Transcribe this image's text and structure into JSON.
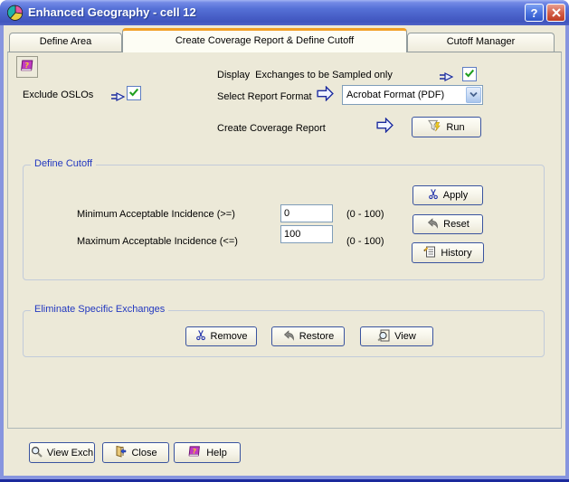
{
  "window": {
    "title": "Enhanced Geography - cell 12"
  },
  "titlebar": {
    "help_glyph": "?"
  },
  "tabs": [
    {
      "label": "Define Area"
    },
    {
      "label": "Create Coverage Report & Define Cutoff"
    },
    {
      "label": "Cutoff Manager"
    }
  ],
  "active_tab": "Create Coverage Report & Define Cutoff",
  "report_section": {
    "display_label": "Display  Exchanges to be Sampled only",
    "display_checked": true,
    "exclude_label": "Exclude OSLOs",
    "exclude_checked": true,
    "format_label": "Select Report Format",
    "format_value": "Acrobat Format (PDF)",
    "create_label": "Create Coverage Report",
    "run_label": "Run"
  },
  "define_cutoff": {
    "title": "Define Cutoff",
    "min_label": "Minimum Acceptable Incidence (>=)",
    "min_value": "0",
    "min_range": "(0 - 100)",
    "max_label": "Maximum Acceptable Incidence (<=)",
    "max_value": "100",
    "max_range": "(0 - 100)",
    "apply_label": "Apply",
    "reset_label": "Reset",
    "history_label": "History"
  },
  "eliminate": {
    "title": "Eliminate Specific Exchanges",
    "remove_label": "Remove",
    "restore_label": "Restore",
    "view_label": "View"
  },
  "footer": {
    "view_exch_label": "View Exch",
    "close_label": "Close",
    "help_label": "Help"
  },
  "colors": {
    "titlebar_blue": "#4A5FC8",
    "frame_blue": "#8795DF",
    "background_beige": "#ECE9D8",
    "active_tab_accent": "#F1A025",
    "check_green": "#1E9E1E",
    "group_caption_blue": "#2238C0",
    "field_border": "#7F9DB9"
  },
  "icons": {
    "app_icon": "pie-chart",
    "titlebar_close": "x-cross",
    "pointer_arrow": "small-right-arrow",
    "big_arrow": "hollow-right-arrow",
    "checkmark": "green-check",
    "run_icon": "funnel-lightning",
    "apply_icon": "scissors",
    "reset_icon": "undo-arrow",
    "history_icon": "note-pencil",
    "remove_icon": "scissors",
    "restore_icon": "undo-arrow",
    "view_icon": "magnifier-document",
    "view_exch_icon": "magnifier",
    "close_icon": "exit-door",
    "help_icon": "purple-book",
    "dropdown_icon": "chevron-down"
  }
}
